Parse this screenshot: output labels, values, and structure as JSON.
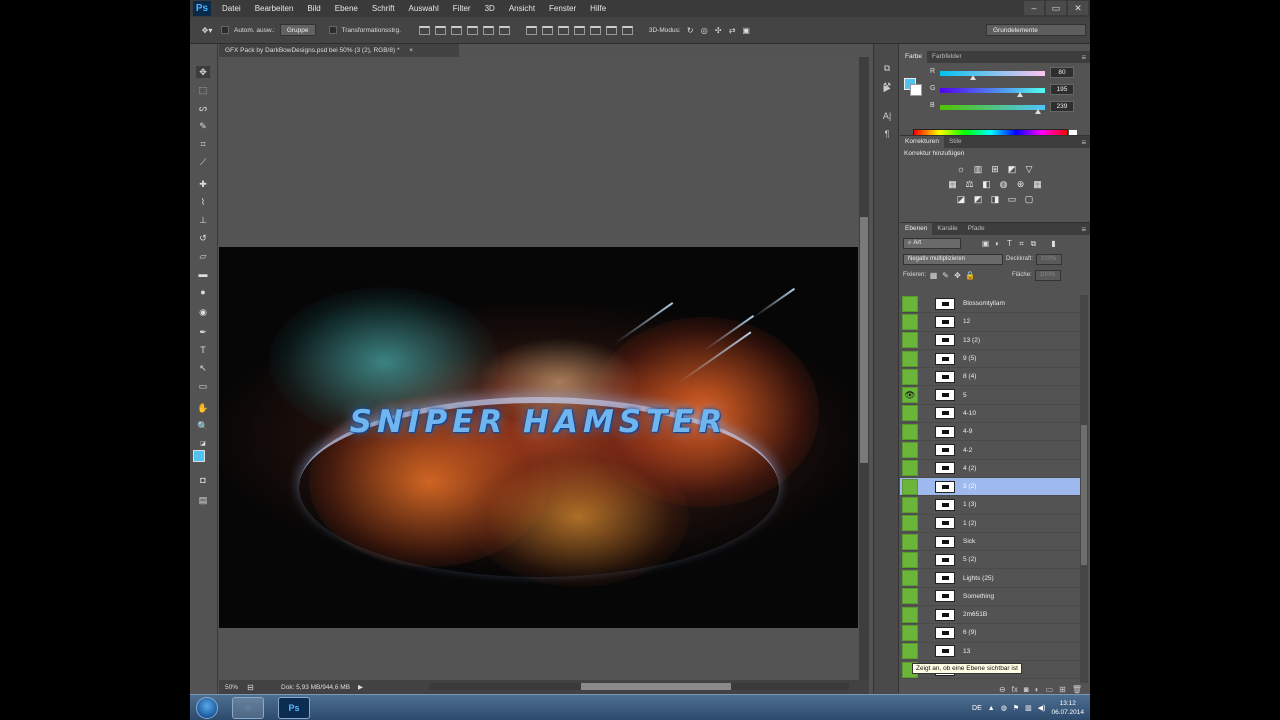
{
  "menubar": {
    "logo": "Ps",
    "items": [
      "Datei",
      "Bearbeiten",
      "Bild",
      "Ebene",
      "Schrift",
      "Auswahl",
      "Filter",
      "3D",
      "Ansicht",
      "Fenster",
      "Hilfe"
    ],
    "window_buttons": [
      "–",
      "▭",
      "✕"
    ]
  },
  "options": {
    "auto_select_label": "Autom. ausw.:",
    "auto_select_value": "Gruppe",
    "transform_label": "Transformationsstrg.",
    "mode_3d_label": "3D-Modus:",
    "workspace": "Grundelemente"
  },
  "document": {
    "tab_title": "GFX Pack by DarkBowDesigns.psd bei 50% (3 (2), RGB/8) *",
    "tab_close": "×",
    "art_text": "SNIPER HAMSTER"
  },
  "status": {
    "zoom": "50%",
    "doc_size": "Dok: 5,93 MB/944,6 MB",
    "arrow": "▶"
  },
  "color_panel": {
    "tabs": [
      "Farbe",
      "Farbfelder"
    ],
    "fg_color": "#50C3EF",
    "bg_color": "#FFFFFF",
    "channels": [
      {
        "label": "R",
        "value": "80",
        "fraction": 0.314
      },
      {
        "label": "G",
        "value": "195",
        "fraction": 0.765
      },
      {
        "label": "B",
        "value": "239",
        "fraction": 0.937
      }
    ]
  },
  "adjustments_panel": {
    "tabs": [
      "Korrekturen",
      "Stile"
    ],
    "title": "Korrektur hinzufügen",
    "icons": [
      [
        "brightness-icon",
        "levels-icon",
        "curves-icon",
        "exposure-icon",
        "vibrance-icon"
      ],
      [
        "hue-icon",
        "balance-icon",
        "bw-icon",
        "photofilter-icon",
        "mixer-icon",
        "lookup-icon"
      ],
      [
        "invert-icon",
        "posterize-icon",
        "threshold-icon",
        "gradientmap-icon",
        "selectivecolor-icon"
      ]
    ]
  },
  "layers_panel": {
    "tabs": [
      "Ebenen",
      "Kanäle",
      "Pfade"
    ],
    "filter_kind": "Art",
    "blend_mode": "Negativ multiplizieren",
    "opacity_label": "Deckkraft:",
    "opacity_value": "100%",
    "lock_label": "Fixieren:",
    "fill_label": "Fläche:",
    "fill_value": "100%",
    "layers": [
      {
        "name": "Blossomtyllam",
        "eye": ""
      },
      {
        "name": "12",
        "eye": ""
      },
      {
        "name": "13 (2)",
        "eye": ""
      },
      {
        "name": "9 (5)",
        "eye": ""
      },
      {
        "name": "8 (4)",
        "eye": ""
      },
      {
        "name": "5",
        "eye": "👁"
      },
      {
        "name": "4-10",
        "eye": ""
      },
      {
        "name": "4-9",
        "eye": ""
      },
      {
        "name": "4-2",
        "eye": ""
      },
      {
        "name": "4 (2)",
        "eye": ""
      },
      {
        "name": "3 (2)",
        "eye": "",
        "selected": true
      },
      {
        "name": "1 (3)",
        "eye": ""
      },
      {
        "name": "1 (2)",
        "eye": ""
      },
      {
        "name": "Sick",
        "eye": ""
      },
      {
        "name": "5 (2)",
        "eye": ""
      },
      {
        "name": "Lights (25)",
        "eye": ""
      },
      {
        "name": "Something",
        "eye": ""
      },
      {
        "name": "2m651B",
        "eye": ""
      },
      {
        "name": "6 (9)",
        "eye": ""
      },
      {
        "name": "13",
        "eye": ""
      },
      {
        "name": "",
        "eye": ""
      }
    ],
    "tooltip": "Zeigt an, ob eine Ebene sichtbar ist"
  },
  "taskbar": {
    "ps_button": "Ps",
    "language": "DE",
    "time": "13:12",
    "date": "06.07.2014"
  }
}
